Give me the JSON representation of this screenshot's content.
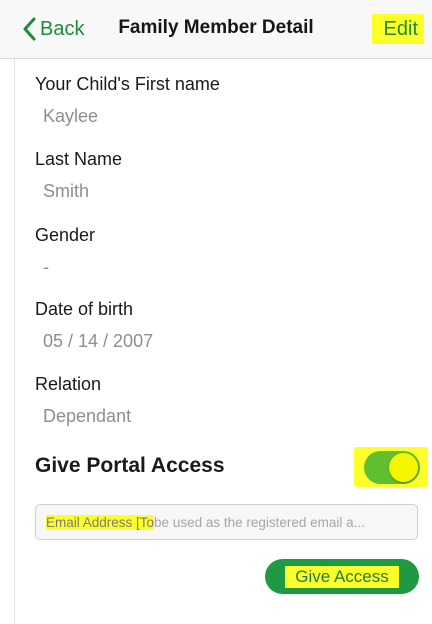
{
  "navbar": {
    "back_label": "Back",
    "back_icon": "chevron-left-icon",
    "title": "Family Member Detail",
    "edit_label": "Edit"
  },
  "fields": [
    {
      "label": "Your Child's First name",
      "value": "Kaylee"
    },
    {
      "label": "Last Name",
      "value": "Smith"
    },
    {
      "label": "Gender",
      "value": "-"
    },
    {
      "label": "Date of birth",
      "value": "05 / 14 / 2007"
    },
    {
      "label": "Relation",
      "value": "Dependant"
    }
  ],
  "portal": {
    "label": "Give Portal Access",
    "toggle_on": true
  },
  "email": {
    "placeholder_highlighted": "Email Address [To",
    "placeholder_rest": " be used as the registered email a..."
  },
  "give_access_label": "Give Access",
  "colors": {
    "accent_green": "#1f8a3a",
    "toggle_green": "#5fbf2f",
    "button_green": "#1e9a42",
    "highlight_yellow": "#fcff2a"
  }
}
